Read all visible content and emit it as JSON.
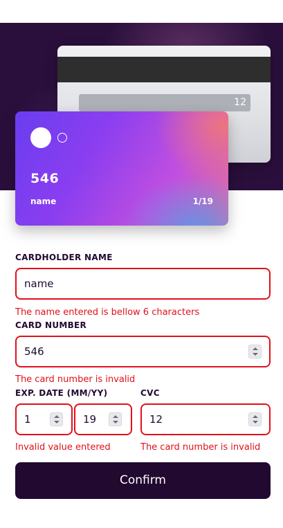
{
  "card_back": {
    "cvc": "12"
  },
  "card_front": {
    "number": "546",
    "holder": "name",
    "expiry": "1/19"
  },
  "form": {
    "cardholder": {
      "label": "CARDHOLDER NAME",
      "value": "name",
      "error": "The name entered is bellow 6 characters"
    },
    "card_number": {
      "label": "CARD NUMBER",
      "value": "546",
      "error": "The card number is invalid"
    },
    "exp_date": {
      "label": "EXP. DATE (MM/YY)",
      "month": "1",
      "year": "19",
      "error": "Invalid value entered"
    },
    "cvc": {
      "label": "CVC",
      "value": "12",
      "error": "The card number is invalid"
    },
    "confirm_label": "Confirm"
  },
  "colors": {
    "accent": "#21092f",
    "error": "#e0101a"
  }
}
